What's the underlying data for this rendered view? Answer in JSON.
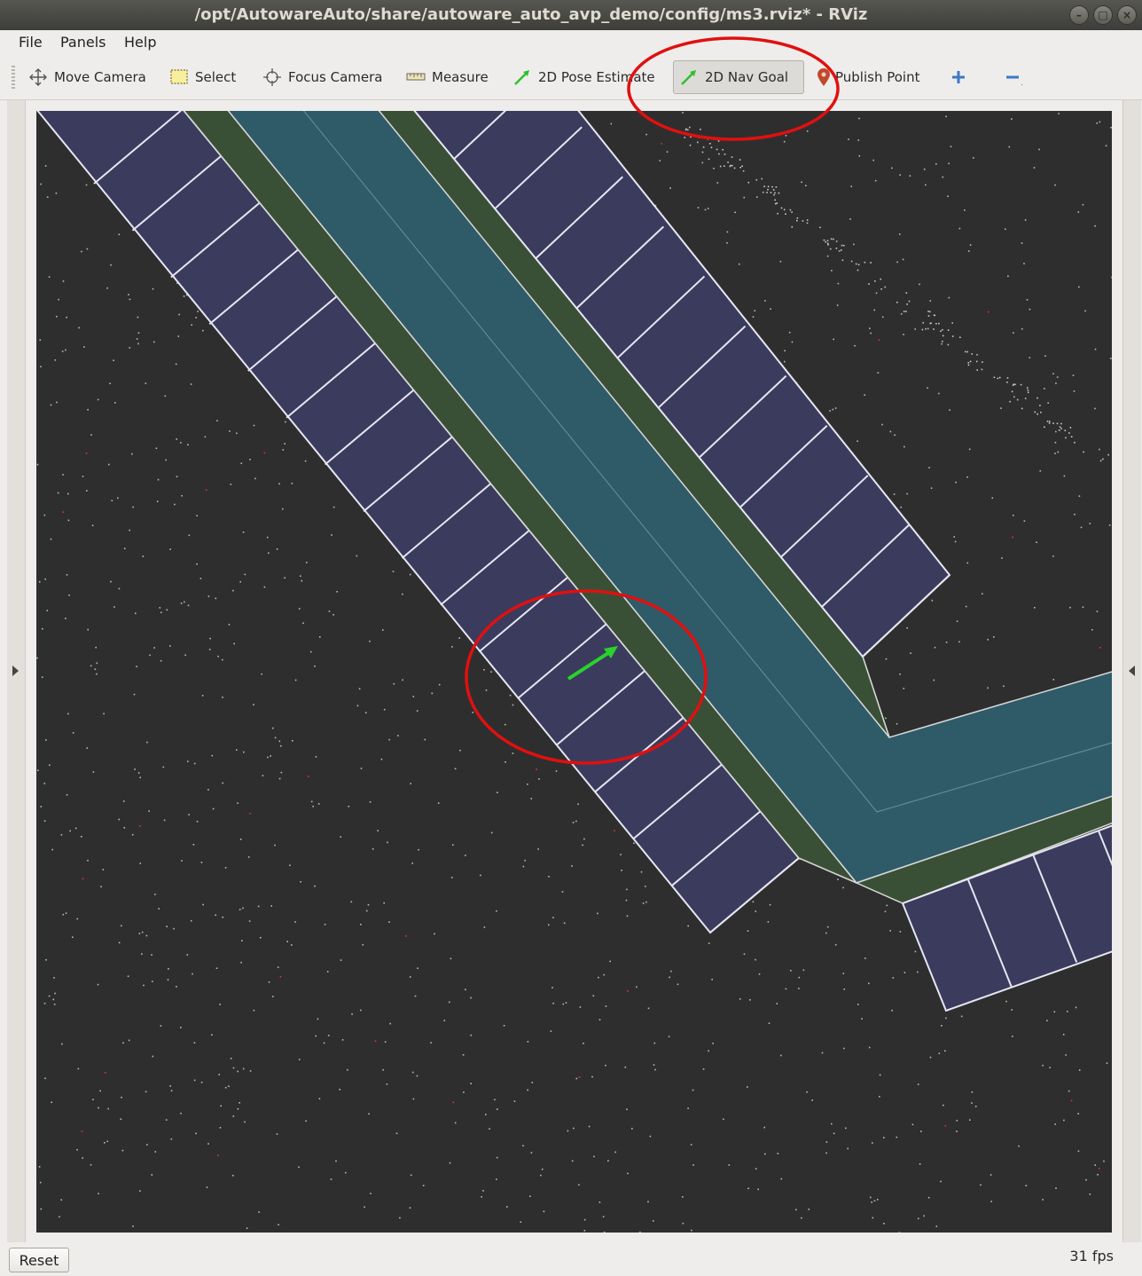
{
  "window": {
    "title": "/opt/AutowareAuto/share/autoware_auto_avp_demo/config/ms3.rviz* - RViz",
    "controls": [
      "minimize",
      "maximize",
      "close"
    ]
  },
  "menubar": {
    "items": [
      "File",
      "Panels",
      "Help"
    ]
  },
  "toolbar": {
    "tools": [
      {
        "label": "Move Camera",
        "icon": "move-camera-icon",
        "active": false
      },
      {
        "label": "Select",
        "icon": "select-icon",
        "active": false
      },
      {
        "label": "Focus Camera",
        "icon": "focus-camera-icon",
        "active": false
      },
      {
        "label": "Measure",
        "icon": "measure-icon",
        "active": false
      },
      {
        "label": "2D Pose Estimate",
        "icon": "pose-estimate-arrow-icon",
        "active": false
      },
      {
        "label": "2D Nav Goal",
        "icon": "nav-goal-arrow-icon",
        "active": true
      },
      {
        "label": "Publish Point",
        "icon": "map-pin-icon",
        "active": false
      }
    ],
    "extra_icons": [
      "add-tool-icon",
      "remove-tool-icon"
    ]
  },
  "viewport": {
    "background": "#2e2e2e",
    "colors": {
      "lane": "#2f5b69",
      "shoulder": "#3a5036",
      "parking_spot": "#3b3b5e",
      "spot_outline": "#e6e6f2",
      "goal_arrow": "#29d32b",
      "annotation": "#e01010"
    },
    "icons": [
      "nav-goal-pose-arrow"
    ]
  },
  "status": {
    "reset_label": "Reset",
    "fps": "31 fps"
  }
}
